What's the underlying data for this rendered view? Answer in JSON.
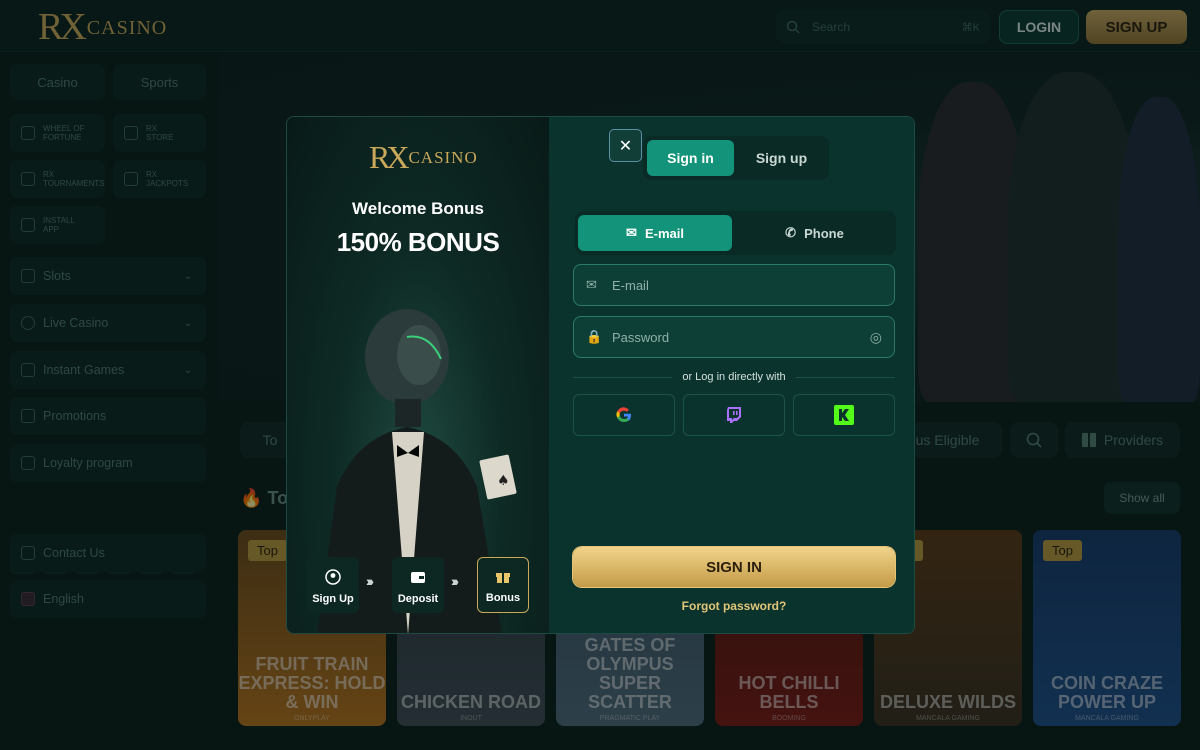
{
  "header": {
    "logo_rx": "RX",
    "logo_text": "CASINO",
    "search_placeholder": "Search",
    "search_shortcut": "⌘K",
    "login_label": "LOGIN",
    "signup_label": "SIGN UP"
  },
  "sidebar": {
    "tabs": [
      "Casino",
      "Sports"
    ],
    "tiles": [
      {
        "label1": "WHEEL OF",
        "label2": "FORTUNE"
      },
      {
        "label1": "RX",
        "label2": "STORE"
      },
      {
        "label1": "RX",
        "label2": "TOURNAMENTS"
      },
      {
        "label1": "RX",
        "label2": "JACKPOTS"
      },
      {
        "label1": "INSTALL",
        "label2": "APP"
      }
    ],
    "items": [
      "Slots",
      "Live Casino",
      "Instant Games",
      "Promotions",
      "Loyalty program",
      "Contact Us",
      "English"
    ]
  },
  "main": {
    "filter_left": "To",
    "filter_bonus": "onus Eligible",
    "filter_providers": "Providers",
    "section_title": "Top",
    "show_all": "Show all",
    "cards": [
      {
        "badge": "Top",
        "title": "FRUIT TRAIN EXPRESS: HOLD & WIN",
        "provider": "ONLYPLAY",
        "color": "#b5731e"
      },
      {
        "badge": "",
        "title": "CHICKEN ROAD",
        "provider": "INOUT",
        "color": "#3f4b55"
      },
      {
        "badge": "",
        "title": "GATES OF OLYMPUS SUPER SCATTER",
        "provider": "PRAGMATIC PLAY",
        "color": "#4f6a7c"
      },
      {
        "badge": "",
        "title": "HOT CHILLI BELLS",
        "provider": "BOOMING",
        "color": "#7a1a14"
      },
      {
        "badge": "Top",
        "title": "DELUXE WILDS",
        "provider": "MANCALA GAMING",
        "color": "#3a3021"
      },
      {
        "badge": "Top",
        "title": "COIN CRAZE POWER UP",
        "provider": "MANCALA GAMING",
        "color": "#1e4f8a"
      }
    ]
  },
  "modal": {
    "logo_rx": "RX",
    "logo_text": "CASINO",
    "welcome": "Welcome Bonus",
    "bonus": "150% BONUS",
    "steps": [
      "Sign Up",
      "Deposit",
      "Bonus"
    ],
    "tab_signin": "Sign in",
    "tab_signup": "Sign up",
    "method_email": "E-mail",
    "method_phone": "Phone",
    "email_placeholder": "E-mail",
    "password_placeholder": "Password",
    "or_text": "or Log in directly with",
    "signin_button": "SIGN IN",
    "forgot": "Forgot password?",
    "colors": {
      "accent": "#13937a",
      "gold": "#c9a85a"
    }
  }
}
